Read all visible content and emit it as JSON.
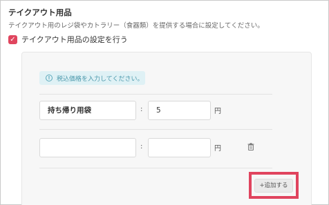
{
  "section": {
    "title": "テイクアウト用品",
    "description": "テイクアウト用のレジ袋やカトラリー（食器類）を提供する場合に設定してください。",
    "checkbox_label": "テイクアウト用品の設定を行う",
    "checkbox_checked": true
  },
  "notice": {
    "text": "税込価格を入力してください。"
  },
  "items": [
    {
      "name": "持ち帰り用袋",
      "separator": ":",
      "price": "5",
      "unit": "円"
    },
    {
      "name": "",
      "separator": ":",
      "price": "",
      "unit": "円"
    }
  ],
  "add_button": {
    "label": "+追加する"
  },
  "colors": {
    "accent": "#e0455e",
    "notice_bg": "#dff1f5",
    "notice_text": "#4a98ab",
    "highlight": "#e0445e"
  },
  "icons": {
    "checkbox": "check-icon",
    "notice": "info-icon",
    "delete": "trash-icon"
  }
}
